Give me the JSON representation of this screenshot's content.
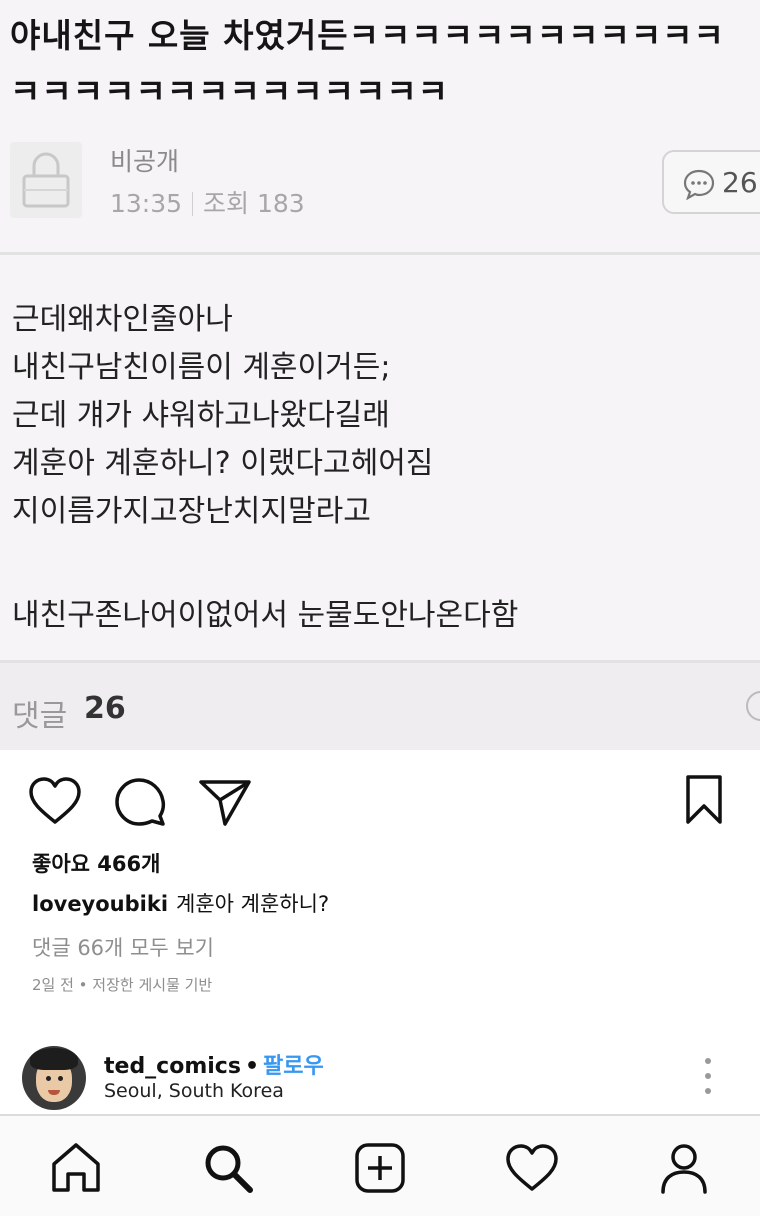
{
  "post": {
    "title": "야내친구 오늘 차였거든ㅋㅋㅋㅋㅋㅋㅋㅋㅋㅋㅋㅋㅋㅋㅋㅋㅋㅋㅋㅋㅋㅋㅋㅋㅋㅋ",
    "author": "비공개",
    "time": "13:35",
    "views_label": "조회 183",
    "comment_count": "26",
    "body_lines": [
      "근데왜차인줄아나",
      "내친구남친이름이 계훈이거든;",
      "근데 걔가 샤워하고나왔다길래",
      "계훈아 계훈하니? 이랬다고헤어짐",
      "지이름가지고장난치지말라고"
    ],
    "body_last": "내친구존나어이없어서 눈물도안나온다함",
    "comments_label": "댓글",
    "comments_num": "26"
  },
  "insta": {
    "likes": "좋아요 466개",
    "caption_user": "loveyoubiki",
    "caption_text": "계훈아 계훈하니?",
    "view_all": "댓글 66개 모두 보기",
    "time_line": "2일 전 • 저장한 게시물 기반",
    "author": "ted_comics",
    "dot": "•",
    "follow": "팔로우",
    "location": "Seoul, South Korea"
  },
  "icons": {
    "like": "heart-icon",
    "comment": "comment-bubble-icon",
    "share": "paper-plane-icon",
    "save": "bookmark-icon",
    "home": "home-icon",
    "search": "search-icon",
    "create": "plus-square-icon",
    "activity": "heart-icon",
    "profile": "person-icon"
  },
  "colors": {
    "follow": "#3897f0",
    "muted": "#8e8e8e"
  }
}
